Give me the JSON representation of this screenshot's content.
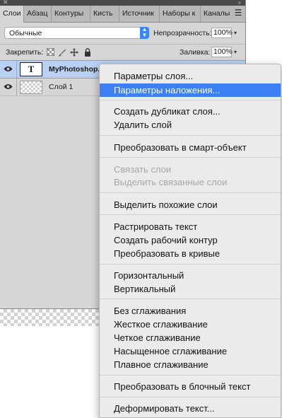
{
  "panel": {
    "tabs": [
      "Слои",
      "Абзац",
      "Контуры",
      "Кисть",
      "Источник",
      "Наборы к",
      "Каналы"
    ],
    "blend_mode": "Обычные",
    "opacity_label": "Непрозрачность:",
    "opacity_value": "100%",
    "lock_label": "Закрепить:",
    "fill_label": "Заливка:",
    "fill_value": "100%",
    "layers": [
      {
        "name": "MyPhotoshop.r",
        "thumb": "T",
        "type": "text",
        "selected": true
      },
      {
        "name": "Слой 1",
        "type": "raster",
        "selected": false
      }
    ]
  },
  "context_menu": {
    "items": [
      {
        "label": "Параметры слоя...",
        "state": "normal"
      },
      {
        "label": "Параметры наложения...",
        "state": "highlighted"
      },
      {
        "label": "Создать дубликат слоя...",
        "state": "normal"
      },
      {
        "label": "Удалить слой",
        "state": "normal"
      },
      {
        "label": "Преобразовать в смарт-объект",
        "state": "normal"
      },
      {
        "label": "Связать слои",
        "state": "disabled"
      },
      {
        "label": "Выделить связанные слои",
        "state": "disabled"
      },
      {
        "label": "Выделить похожие слои",
        "state": "normal"
      },
      {
        "label": "Растрировать текст",
        "state": "normal"
      },
      {
        "label": "Создать рабочий контур",
        "state": "normal"
      },
      {
        "label": "Преобразовать в кривые",
        "state": "normal"
      },
      {
        "label": "Горизонтальный",
        "state": "normal"
      },
      {
        "label": "Вертикальный",
        "state": "normal"
      },
      {
        "label": "Без сглаживания",
        "state": "normal"
      },
      {
        "label": "Жесткое сглаживание",
        "state": "normal"
      },
      {
        "label": "Четкое сглаживание",
        "state": "normal"
      },
      {
        "label": "Насыщенное сглаживание",
        "state": "normal"
      },
      {
        "label": "Плавное сглаживание",
        "state": "normal"
      },
      {
        "label": "Преобразовать в блочный текст",
        "state": "normal"
      },
      {
        "label": "Деформировать текст...",
        "state": "normal"
      }
    ]
  },
  "colors": {
    "highlight": "#3d7ff5",
    "selected_layer": "#b8d1f3",
    "disabled_text": "#a6a6a6"
  }
}
